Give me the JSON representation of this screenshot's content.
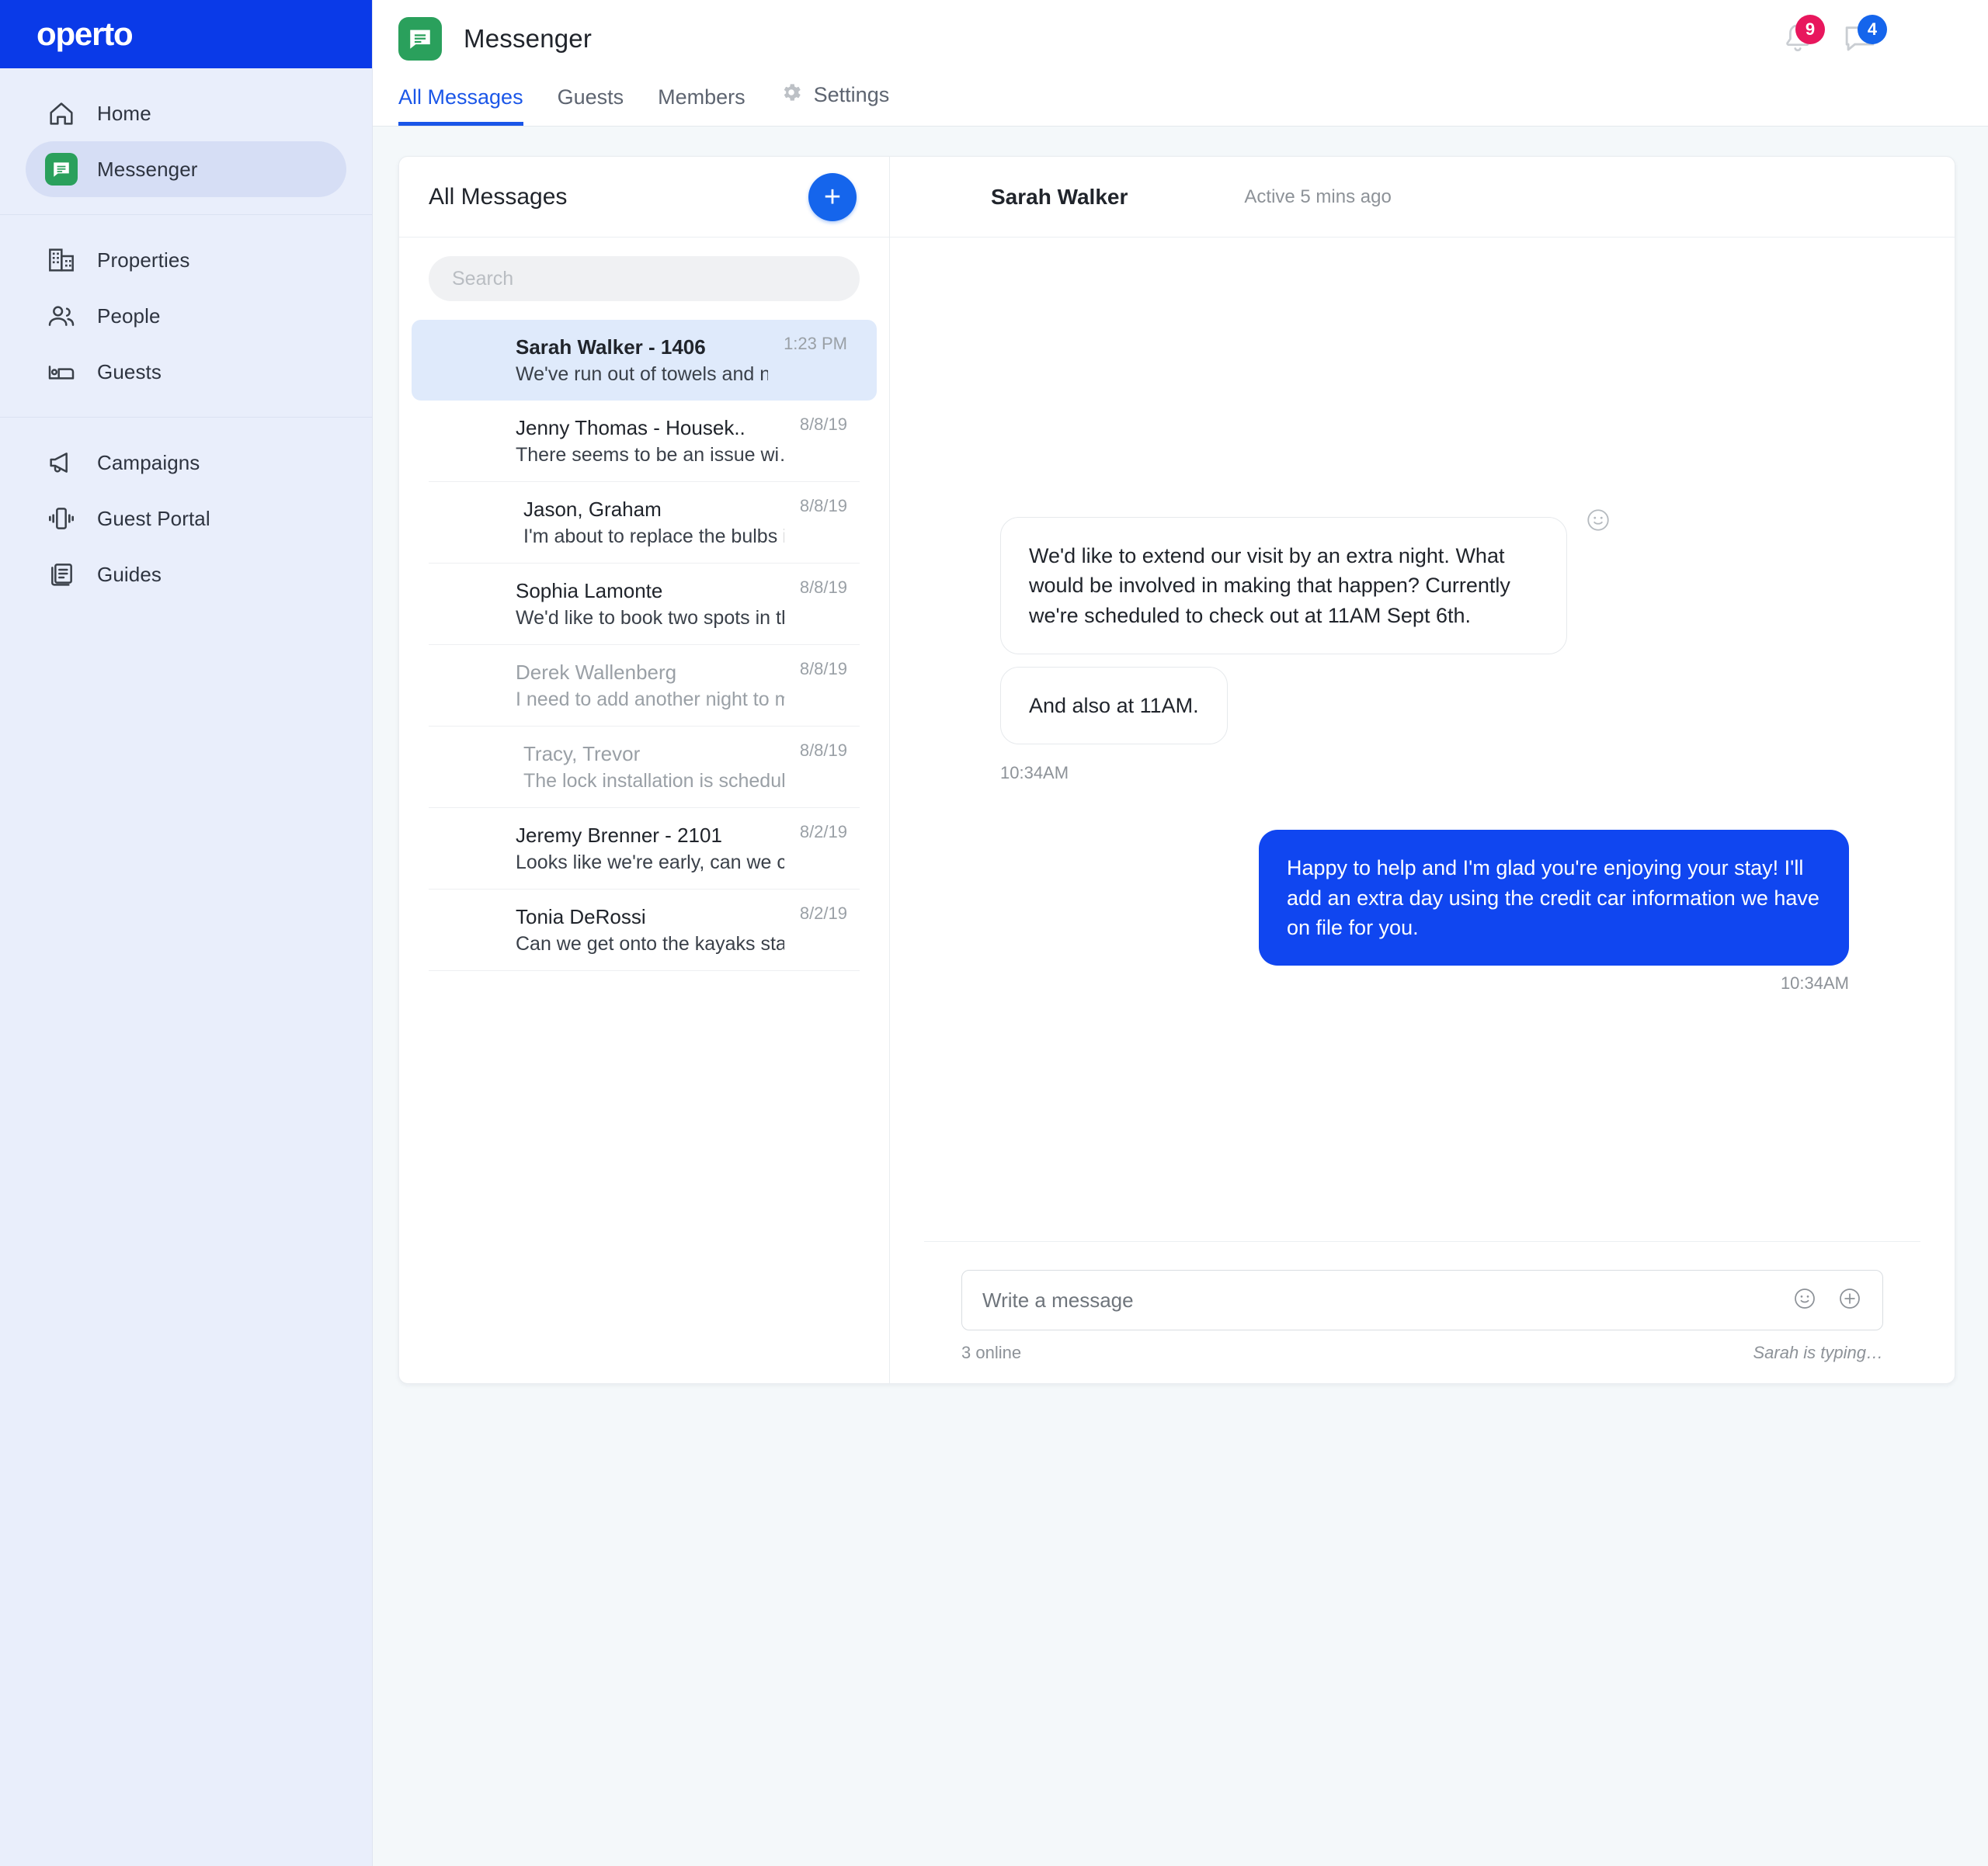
{
  "brand": {
    "name": "operto"
  },
  "sidebar": {
    "groups": [
      {
        "items": [
          {
            "label": "Home",
            "icon": "home-icon",
            "active": false
          },
          {
            "label": "Messenger",
            "icon": "messenger-icon",
            "active": true
          }
        ]
      },
      {
        "items": [
          {
            "label": "Properties",
            "icon": "building-icon",
            "active": false
          },
          {
            "label": "People",
            "icon": "people-icon",
            "active": false
          },
          {
            "label": "Guests",
            "icon": "bed-icon",
            "active": false
          }
        ]
      },
      {
        "items": [
          {
            "label": "Campaigns",
            "icon": "megaphone-icon",
            "active": false
          },
          {
            "label": "Guest Portal",
            "icon": "device-vibrate-icon",
            "active": false
          },
          {
            "label": "Guides",
            "icon": "guides-icon",
            "active": false
          }
        ]
      }
    ]
  },
  "topbar": {
    "app_title": "Messenger",
    "app_icon": "messenger-icon",
    "notifications_count": "9",
    "messages_count": "4",
    "tabs": [
      {
        "label": "All Messages",
        "active": true
      },
      {
        "label": "Guests",
        "active": false
      },
      {
        "label": "Members",
        "active": false
      },
      {
        "label": "Settings",
        "active": false,
        "icon": "gear-icon"
      }
    ]
  },
  "list_pane": {
    "title": "All Messages",
    "new_button_label": "+",
    "search_placeholder": "Search",
    "search_value": "",
    "conversations": [
      {
        "name": "Sarah Walker - 1406",
        "preview": "We've run out of towels and nee…",
        "time": "1:23 PM",
        "selected": true,
        "unread": true,
        "muted": false,
        "pair": false,
        "has_read_receipt": true
      },
      {
        "name": "Jenny Thomas - Housek..",
        "preview": "There seems to be an issue wi…",
        "time": "8/8/19",
        "selected": false,
        "unread": false,
        "muted": false,
        "pair": false,
        "has_read_receipt": false
      },
      {
        "name": "Jason, Graham",
        "preview": "I'm about to replace the bulbs in un..",
        "time": "8/8/19",
        "selected": false,
        "unread": false,
        "muted": false,
        "pair": true,
        "has_read_receipt": true
      },
      {
        "name": "Sophia Lamonte",
        "preview": "We'd like to book two spots in the spa fo..",
        "time": "8/8/19",
        "selected": false,
        "unread": false,
        "muted": false,
        "pair": false,
        "has_read_receipt": false
      },
      {
        "name": "Derek Wallenberg",
        "preview": "I need to add another night to my stay, ca…",
        "time": "8/8/19",
        "selected": false,
        "unread": false,
        "muted": true,
        "pair": false,
        "has_read_receipt": false
      },
      {
        "name": "Tracy, Trevor",
        "preview": "The lock installation is scheduled for tomo..",
        "time": "8/8/19",
        "selected": false,
        "unread": false,
        "muted": true,
        "pair": true,
        "has_read_receipt": false
      },
      {
        "name": "Jeremy Brenner - 2101",
        "preview": "Looks like we're early, can we check in?",
        "time": "8/2/19",
        "selected": false,
        "unread": false,
        "muted": false,
        "pair": false,
        "has_read_receipt": false
      },
      {
        "name": "Tonia DeRossi",
        "preview": "Can we get onto the kayaks standby list?",
        "time": "8/2/19",
        "selected": false,
        "unread": false,
        "muted": false,
        "pair": false,
        "has_read_receipt": false
      }
    ]
  },
  "chat": {
    "header": {
      "name": "Sarah Walker",
      "status": "Active 5 mins ago"
    },
    "incoming": {
      "bubbles": [
        "We'd like to extend our visit by an extra night. What would be involved in making that happen? Currently we're scheduled to check out at 11AM Sept 6th.",
        "And also at 11AM."
      ],
      "time": "10:34AM"
    },
    "outgoing": {
      "text": "Happy to help and I'm glad you're enjoying your stay! I'll add an extra day using the credit car information we have on file for you.",
      "time": "10:34AM"
    },
    "composer": {
      "placeholder": "Write a message",
      "value": "",
      "emoji_icon": "emoji-icon",
      "attach_icon": "plus-circle-icon",
      "online_text": "3 online",
      "typing_text": "Sarah is typing…"
    }
  },
  "colors": {
    "brand_blue": "#0a3ae8",
    "accent_blue": "#1565ec",
    "bubble_blue": "#1046f0",
    "messenger_green": "#2aa05c",
    "badge_pink": "#e8175d",
    "sidebar_bg": "#e9eefb",
    "page_bg": "#f4f8fa"
  }
}
